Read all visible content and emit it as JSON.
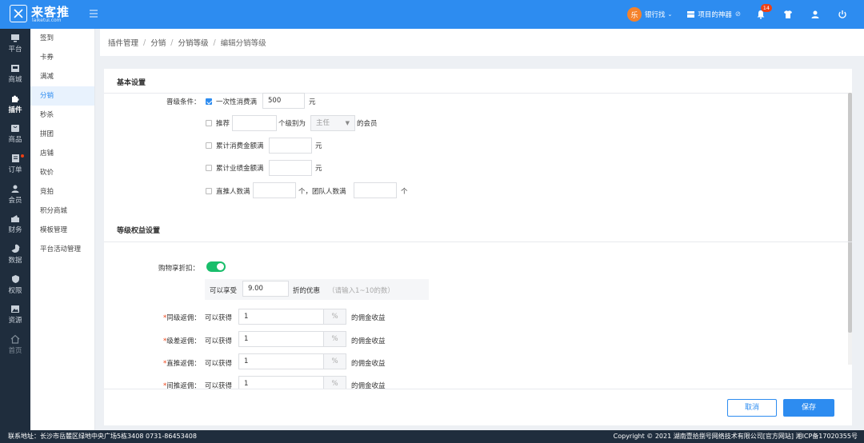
{
  "header": {
    "logo_name": "来客推",
    "logo_domain": "laiketui.com",
    "avatar_text": "乐",
    "user_name": "银行找",
    "store_name": "项目的神器",
    "notification_count": "14"
  },
  "nav": {
    "items": [
      {
        "label": "平台",
        "icon": "monitor-icon"
      },
      {
        "label": "商城",
        "icon": "store-icon"
      },
      {
        "label": "插件",
        "icon": "puzzle-icon"
      },
      {
        "label": "商品",
        "icon": "goods-icon"
      },
      {
        "label": "订单",
        "icon": "order-icon"
      },
      {
        "label": "会员",
        "icon": "member-icon"
      },
      {
        "label": "财务",
        "icon": "finance-icon"
      },
      {
        "label": "数据",
        "icon": "chart-icon"
      },
      {
        "label": "权限",
        "icon": "permission-icon"
      },
      {
        "label": "资源",
        "icon": "resource-icon"
      },
      {
        "label": "首页",
        "icon": "home-icon"
      }
    ]
  },
  "submenu": {
    "items": [
      "签到",
      "卡券",
      "满减",
      "分销",
      "秒杀",
      "拼团",
      "店铺",
      "砍价",
      "竞拍",
      "积分商城",
      "模板管理",
      "平台活动管理"
    ]
  },
  "breadcrumb": [
    "插件管理",
    "分销",
    "分销等级",
    "编辑分销等级"
  ],
  "form": {
    "section_basic": "基本设置",
    "upgrade_label": "晋级条件：",
    "cond1_label": "一次性消费满",
    "cond1_value": "500",
    "unit_yuan": "元",
    "cond2_label": "推荐",
    "cond2_mid": "个级别为",
    "cond2_select": "主任",
    "cond2_suffix": "的会员",
    "cond3_label": "累计消费金额满",
    "cond4_label": "累计业绩金额满",
    "cond5_label": "直推人数满",
    "cond5_mid": "个，团队人数满",
    "unit_ge": "个",
    "section_level": "等级权益设置",
    "discount_label": "购物享折扣：",
    "discount_prefix": "可以享受",
    "discount_value": "9.00",
    "discount_suffix": "折的优惠",
    "discount_hint": "（请输入1~10的数）",
    "rows": [
      {
        "label": "同级返佣：",
        "prefix": "可以获得",
        "value": "1",
        "unit": "%",
        "suffix": "的佣金收益"
      },
      {
        "label": "级差返佣：",
        "prefix": "可以获得",
        "value": "1",
        "unit": "%",
        "suffix": "的佣金收益"
      },
      {
        "label": "直推返佣：",
        "prefix": "可以获得",
        "value": "1",
        "unit": "%",
        "suffix": "的佣金收益"
      },
      {
        "label": "间推返佣：",
        "prefix": "可以获得",
        "value": "1",
        "unit": "%",
        "suffix": "的佣金收益"
      }
    ],
    "cancel": "取消",
    "save": "保存"
  },
  "footer": {
    "address": "联系地址：长沙市岳麓区绿地中央广场5栋3408 0731-86453408",
    "copyright": "Copyright © 2021 湖南壹拾捌号网络技术有限公司[官方网站] 湘ICP备17020355号"
  },
  "colors": {
    "primary": "#2d8cf0",
    "nav_bg": "#1f2d3d",
    "toggle_on": "#19be6b",
    "danger": "#ed4014"
  }
}
